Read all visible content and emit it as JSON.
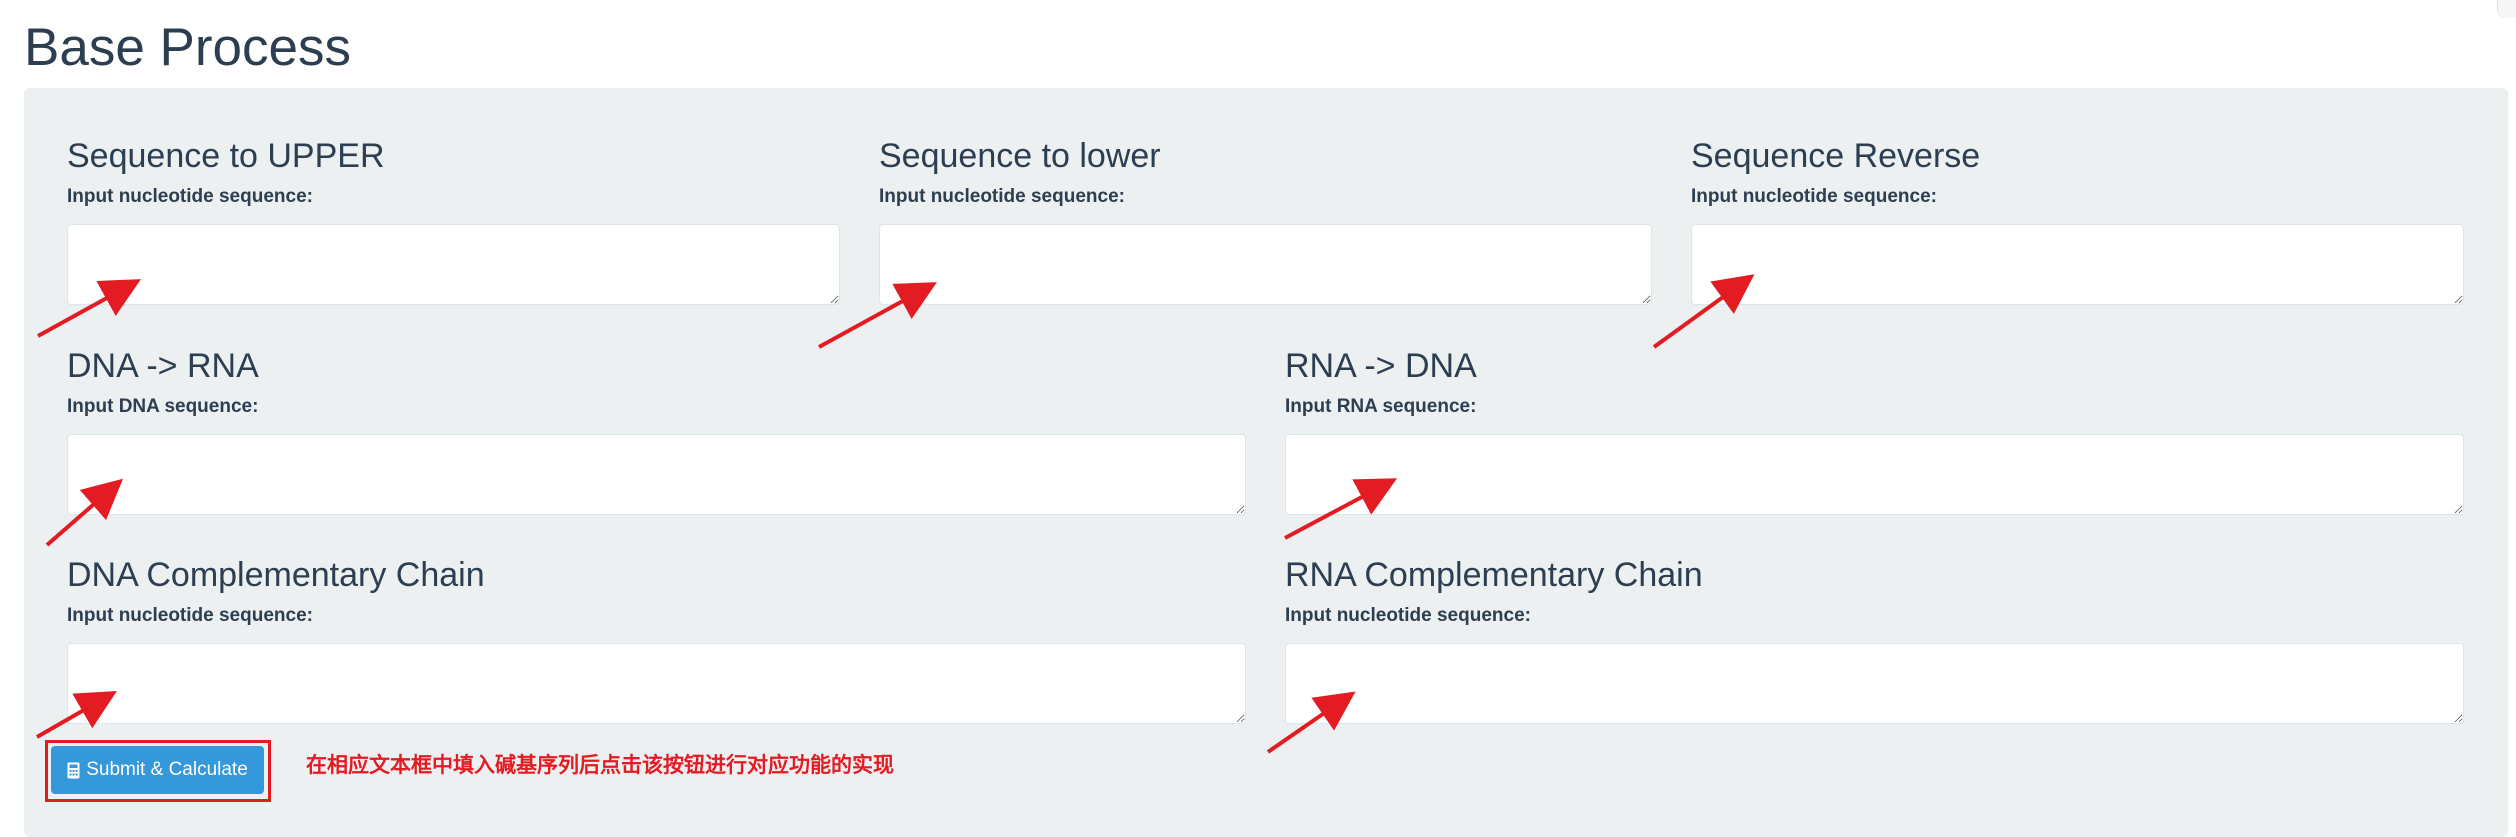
{
  "page": {
    "title": "Base Process"
  },
  "fields": {
    "upper": {
      "title": "Sequence to UPPER",
      "label": "Input nucleotide sequence:",
      "value": ""
    },
    "lower": {
      "title": "Sequence to lower",
      "label": "Input nucleotide sequence:",
      "value": ""
    },
    "reverse": {
      "title": "Sequence Reverse",
      "label": "Input nucleotide sequence:",
      "value": ""
    },
    "dna_to_rna": {
      "title": "DNA -> RNA",
      "label": "Input DNA sequence:",
      "value": ""
    },
    "rna_to_dna": {
      "title": "RNA -> DNA",
      "label": "Input RNA sequence:",
      "value": ""
    },
    "dna_complement": {
      "title": "DNA Complementary Chain",
      "label": "Input nucleotide sequence:",
      "value": ""
    },
    "rna_complement": {
      "title": "RNA Complementary Chain",
      "label": "Input nucleotide sequence:",
      "value": ""
    }
  },
  "submit": {
    "label": "Submit & Calculate",
    "icon": "calculator-icon"
  },
  "annotation": {
    "hint": "在相应文本框中填入碱基序列后点击该按钮进行对应功能的实现",
    "color": "#e31b23"
  },
  "colors": {
    "panel_bg": "#ecf0f1",
    "title_text": "#2c3e50",
    "button_bg": "#3498db",
    "annotation": "#e31b23"
  }
}
